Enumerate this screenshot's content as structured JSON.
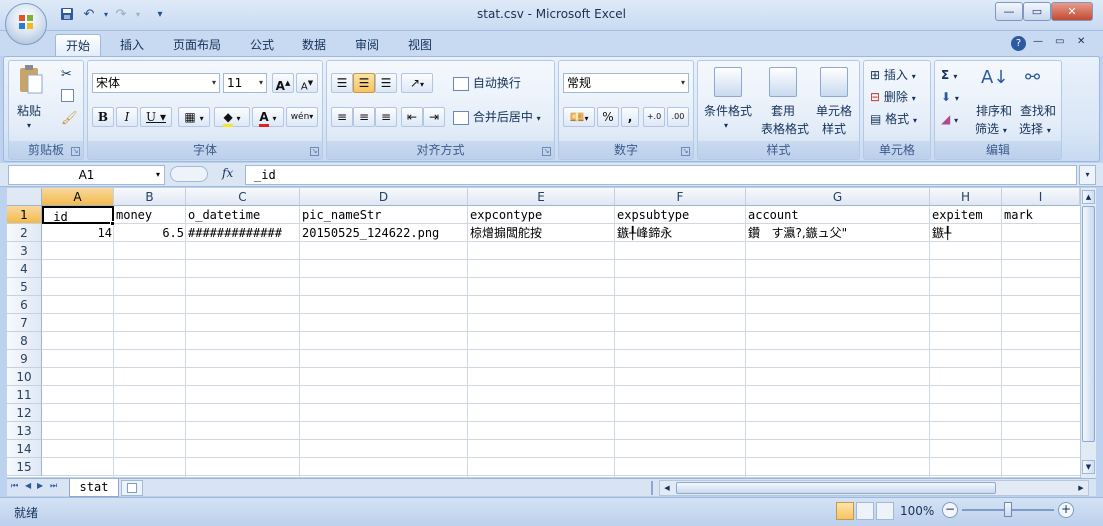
{
  "window": {
    "title": "stat.csv - Microsoft Excel",
    "minimize": "—",
    "maximize": "▭",
    "close": "✕"
  },
  "quick_access": {
    "save_icon": "save-icon",
    "undo_icon": "undo-icon",
    "redo_icon": "redo-icon",
    "customize": "▾"
  },
  "tabs": [
    "开始",
    "插入",
    "页面布局",
    "公式",
    "数据",
    "审阅",
    "视图"
  ],
  "ribbon_right": {
    "help": "?",
    "min": "—",
    "restore": "▭",
    "close": "✕"
  },
  "ribbon": {
    "clipboard": {
      "paste": "粘贴",
      "label": "剪贴板"
    },
    "font": {
      "name": "宋体",
      "size": "11",
      "grow": "A",
      "shrink": "A",
      "bold": "B",
      "italic": "I",
      "underline": "U",
      "font_color_letter": "A",
      "phonetic": "wén",
      "label": "字体"
    },
    "alignment": {
      "wrap": "自动换行",
      "merge": "合并后居中",
      "label": "对齐方式"
    },
    "number": {
      "format": "常规",
      "percent": "%",
      "comma": ",",
      "inc_decimal": "+.0",
      "dec_decimal": ".00",
      "label": "数字"
    },
    "styles": {
      "conditional": "条件格式",
      "table_1": "套用",
      "table_2": "表格格式",
      "cell_1": "单元格",
      "cell_2": "样式",
      "label": "样式"
    },
    "cells": {
      "insert": "插入",
      "delete": "删除",
      "format": "格式",
      "label": "单元格"
    },
    "editing": {
      "sigma": "Σ",
      "sort_1": "排序和",
      "sort_2": "筛选",
      "find_1": "查找和",
      "find_2": "选择",
      "label": "编辑"
    }
  },
  "formula_bar": {
    "name_box": "A1",
    "fx": "fx",
    "content": "_id"
  },
  "grid": {
    "columns": [
      "A",
      "B",
      "C",
      "D",
      "E",
      "F",
      "G",
      "H",
      "I"
    ],
    "rows": [
      "1",
      "2",
      "3",
      "4",
      "5",
      "6",
      "7",
      "8",
      "9",
      "10",
      "11",
      "12",
      "13",
      "14",
      "15"
    ],
    "row1": [
      "_id",
      "money",
      "o_datetime",
      "pic_nameStr",
      "expcontype",
      "expsubtype",
      "account",
      "expitem",
      "mark"
    ],
    "row2": [
      "14",
      "6.5",
      "#############",
      "20150525_124622.png",
      "椋熷搧闆舵按",
      "鏃╀峰鍗永",
      "鑽   す瀛?,鏃ュ父\"",
      "鏃╀",
      ""
    ]
  },
  "sheet_tabs": {
    "active": "stat",
    "nav": [
      "⏮",
      "◀",
      "▶",
      "⏭"
    ]
  },
  "status": {
    "ready": "就绪",
    "zoom": "100%",
    "zoom_minus": "−",
    "zoom_plus": "+"
  }
}
